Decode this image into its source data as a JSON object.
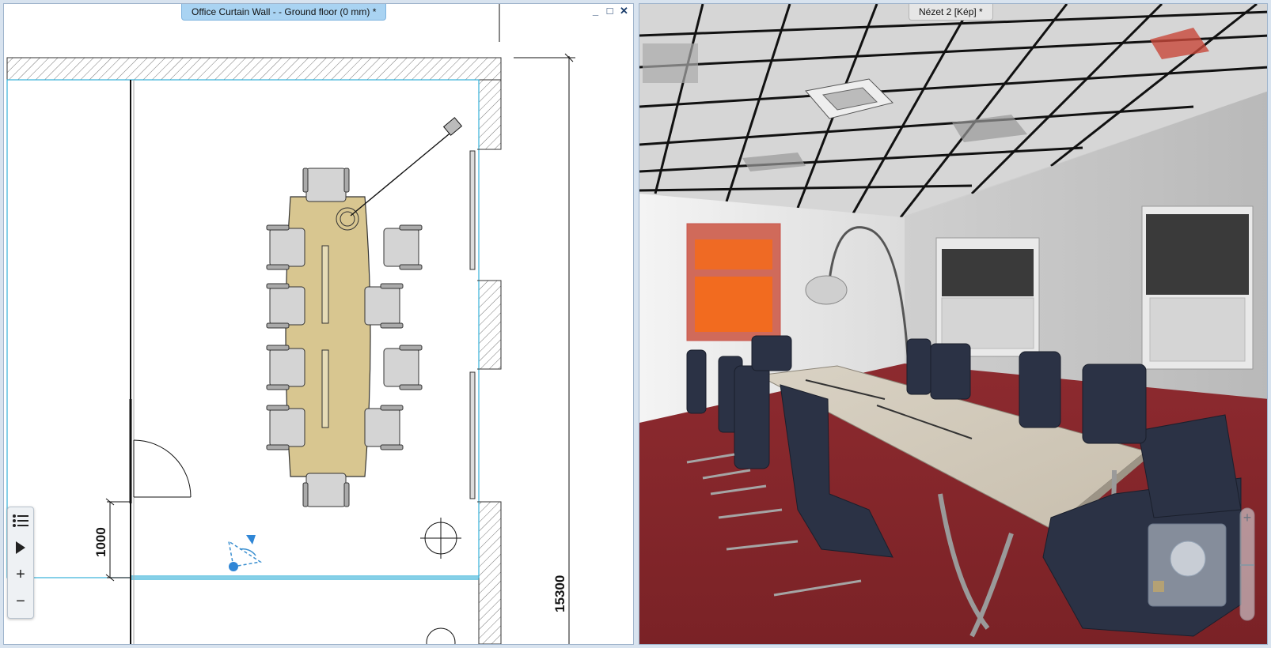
{
  "plan_window": {
    "title": "Office Curtain Wall -  - Ground floor (0 mm) *",
    "buttons": {
      "minimize": "_",
      "maximize": "□",
      "close": "✕"
    },
    "dimension_vertical_small": "1000",
    "dimension_vertical_total": "15300"
  },
  "view_window": {
    "title": "Nézet 2 [Kép] *"
  },
  "toolbar": {
    "list_icon": "list-icon",
    "play_icon": "play-icon",
    "zoom_in_label": "+",
    "zoom_out_label": "−"
  },
  "colors": {
    "plan_tab": "#a9d3f2",
    "table_fill": "#d8c690",
    "carpet": "#8b2a2e",
    "painting_orange": "#ef6a24",
    "chair_dark": "#2b3245"
  }
}
